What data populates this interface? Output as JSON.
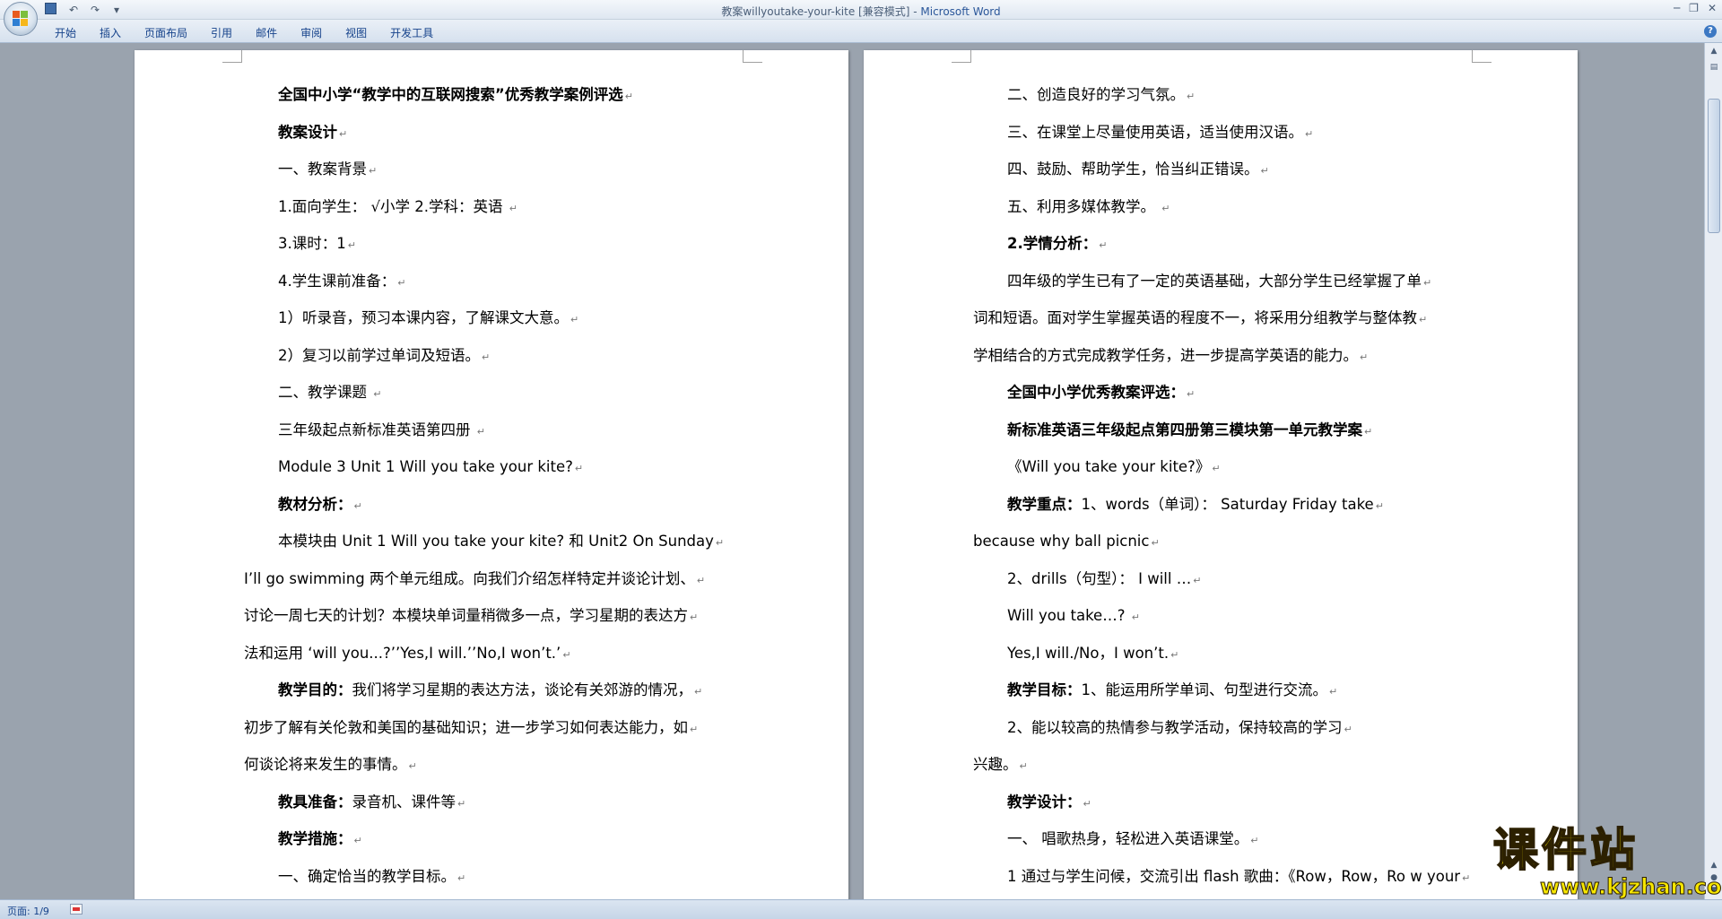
{
  "window": {
    "title": "教案willyoutake-your-kite [兼容模式]",
    "app_name": "Microsoft Word"
  },
  "ribbon_tabs": [
    "开始",
    "插入",
    "页面布局",
    "引用",
    "邮件",
    "审阅",
    "视图",
    "开发工具"
  ],
  "page_left": {
    "lines": [
      {
        "text": "全国中小学“教学中的互联网搜索”优秀教学案例评选",
        "bold": true
      },
      {
        "text": "教案设计",
        "bold": true
      },
      {
        "text": "一、教案背景"
      },
      {
        "text": "1.面向学生：  √小学           2.学科：英语 "
      },
      {
        "text": "3.课时：1"
      },
      {
        "text": "4.学生课前准备："
      },
      {
        "text": "1）听录音，预习本课内容，了解课文大意。"
      },
      {
        "text": "2）复习以前学过单词及短语。"
      },
      {
        "text": "二、教学课题                 "
      },
      {
        "text": "三年级起点新标准英语第四册 "
      },
      {
        "text": "Module 3 Unit 1  Will you take your kite?"
      },
      {
        "text": "教材分析：",
        "bold": true
      },
      {
        "text": "本模块由 Unit 1 Will you take your kite? 和 Unit2 On Sunday"
      },
      {
        "text": "I’ll go swimming 两个单元组成。向我们介绍怎样特定并谈论计划、",
        "noindent": true
      },
      {
        "text": "讨论一周七天的计划？本模块单词量稍微多一点，学习星期的表达方",
        "noindent": true
      },
      {
        "text": "法和运用 ‘will you...?’’Yes,I will.’’No,I won’t.’",
        "noindent": true
      },
      {
        "label": "教学目的：",
        "text": "我们将学习星期的表达方法，谈论有关郊游的情况，"
      },
      {
        "text": "初步了解有关伦敦和美国的基础知识；进一步学习如何表达能力，如",
        "noindent": true
      },
      {
        "text": "何谈论将来发生的事情。",
        "noindent": true
      },
      {
        "label": "教具准备：",
        "text": "录音机、课件等"
      },
      {
        "text": "教学措施：",
        "bold": true
      },
      {
        "text": "一、确定恰当的教学目标。"
      }
    ]
  },
  "page_right": {
    "lines": [
      {
        "text": "二、创造良好的学习气氛。"
      },
      {
        "text": "三、在课堂上尽量使用英语，适当使用汉语。"
      },
      {
        "text": "四、鼓励、帮助学生，恰当纠正错误。"
      },
      {
        "text": "五、利用多媒体教学。 "
      },
      {
        "text": "  2.学情分析：",
        "bold": true
      },
      {
        "text": "四年级的学生已有了一定的英语基础，大部分学生已经掌握了单"
      },
      {
        "text": "词和短语。面对学生掌握英语的程度不一，将采用分组教学与整体教",
        "noindent": true
      },
      {
        "text": "学相结合的方式完成教学任务，进一步提高学英语的能力。",
        "noindent": true
      },
      {
        "text": "全国中小学优秀教案评选：",
        "bold": true
      },
      {
        "text": "新标准英语三年级起点第四册第三模块第一单元教学案",
        "bold": true
      },
      {
        "text": "《Will you take your kite?》"
      },
      {
        "label": "教学重点：",
        "text": "1、words（单词）：   Saturday    Friday   take"
      },
      {
        "text": "because  why  ball picnic",
        "noindent": true
      },
      {
        "text": "2、drills（句型）： I will  …"
      },
      {
        "text": "Will  you  take…? "
      },
      {
        "text": "Yes,I will./No，I won’t."
      },
      {
        "label": "教学目标：",
        "text": "1、能运用所学单词、句型进行交流。"
      },
      {
        "text": "          2、能以较高的热情参与教学活动，保持较高的学习"
      },
      {
        "text": "兴趣。",
        "noindent": true
      },
      {
        "text": "教学设计：",
        "bold": true
      },
      {
        "text": "一、      唱歌热身，轻松进入英语课堂。"
      },
      {
        "text": "1 通过与学生问候，交流引出 flash 歌曲：《Row，Row，Ro w your"
      }
    ]
  },
  "status_bar": {
    "page_info": "页面: 1/9"
  },
  "watermark": {
    "cn": "课件站",
    "url": "www.kjzhan.com"
  },
  "colors": {
    "workspace_bg": "#9aa3ae",
    "tab_text": "#15428b",
    "watermark_fill": "#f6e600"
  }
}
